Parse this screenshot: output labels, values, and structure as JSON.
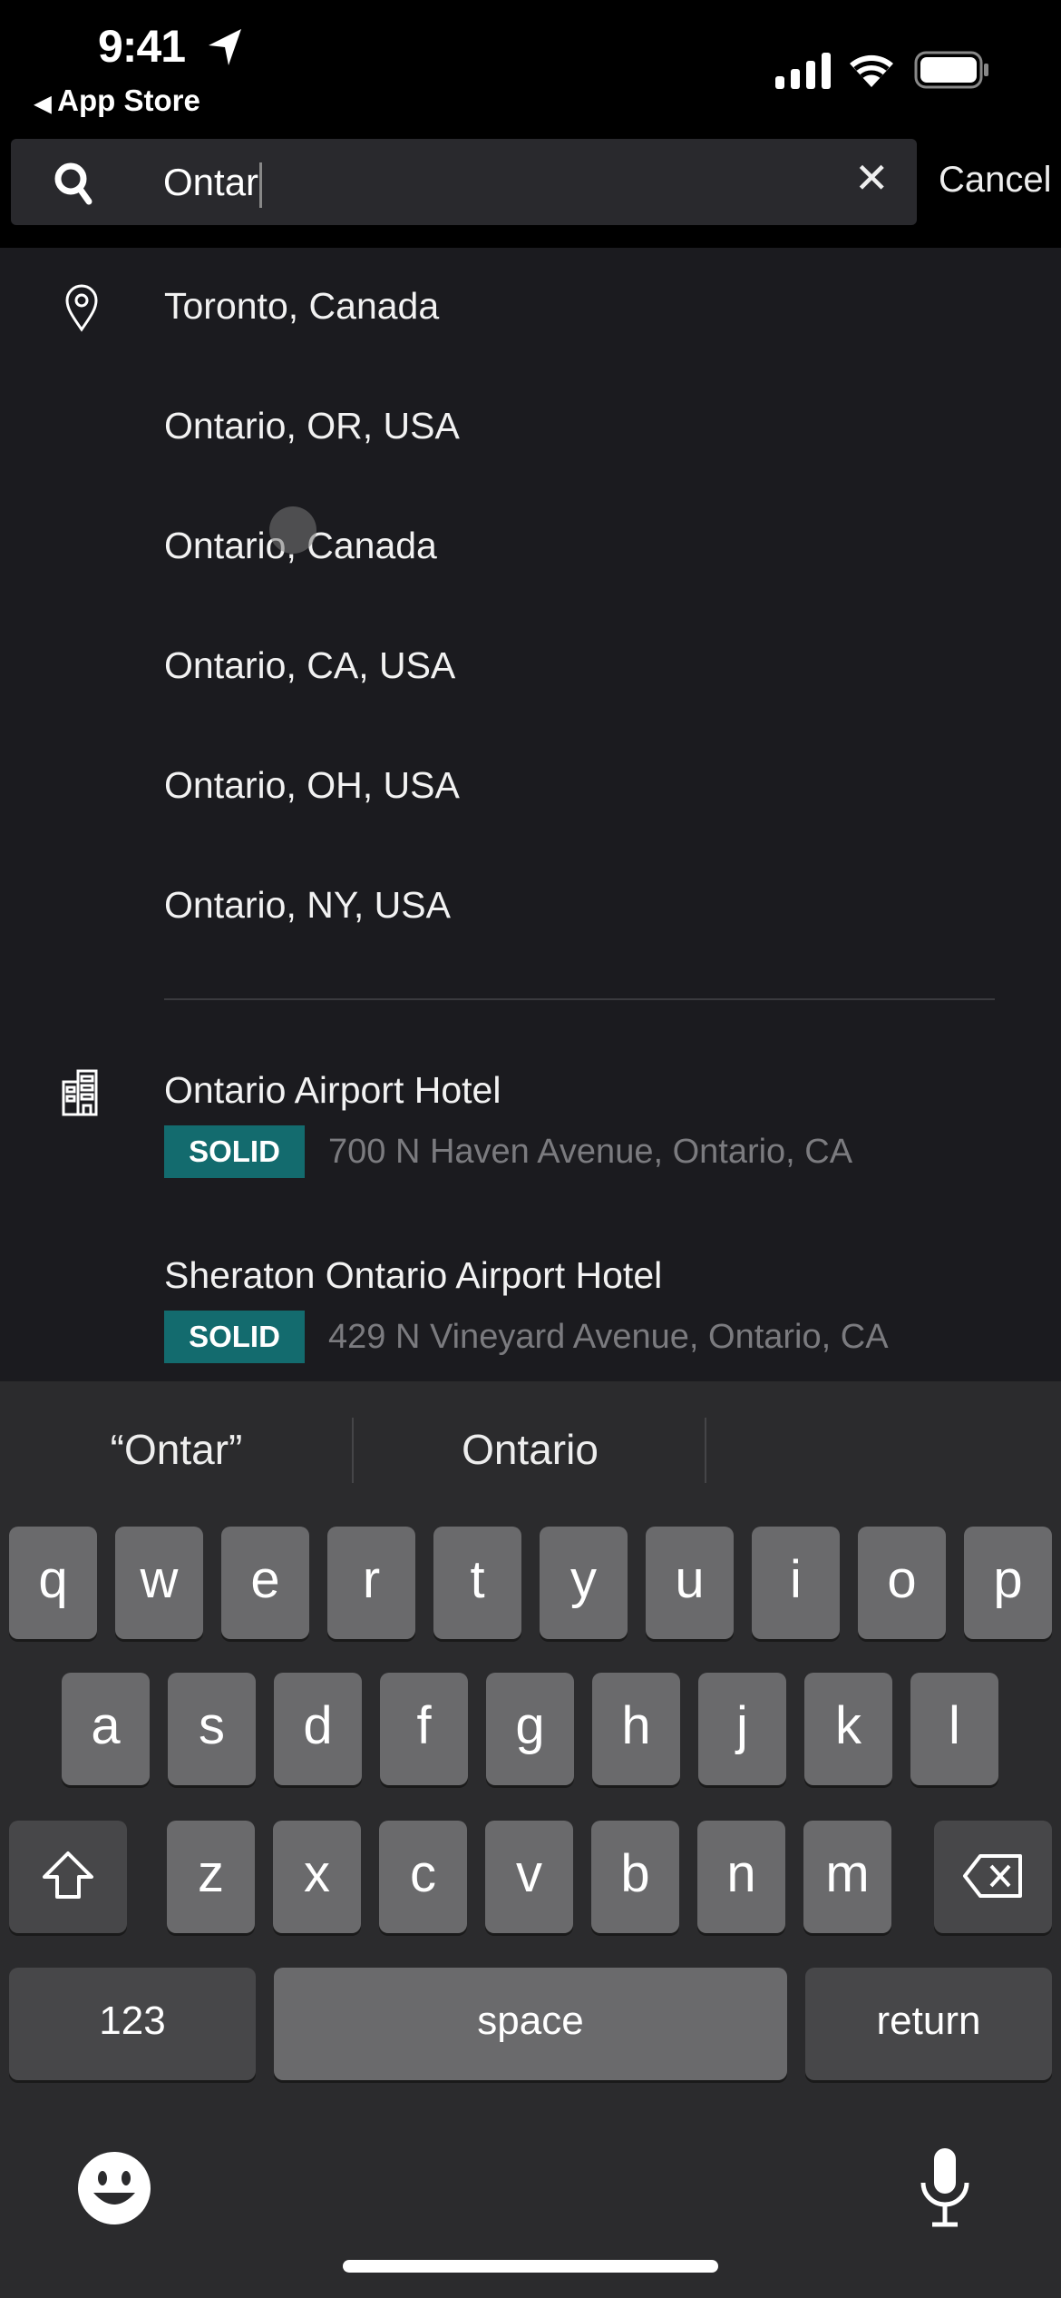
{
  "status_bar": {
    "time": "9:41",
    "back_label": "App Store",
    "icons": [
      "location-arrow-icon",
      "signal-icon",
      "wifi-icon",
      "battery-icon"
    ]
  },
  "search": {
    "value": "Ontar",
    "cancel_label": "Cancel"
  },
  "locations": [
    "Toronto, Canada",
    "Ontario, OR, USA",
    "Ontario, Canada",
    "Ontario, CA, USA",
    "Ontario, OH, USA",
    "Ontario, NY, USA"
  ],
  "hotels": [
    {
      "name": "Ontario Airport Hotel",
      "badge": "SOLID",
      "address": "700 N Haven Avenue, Ontario, CA"
    },
    {
      "name": "Sheraton Ontario Airport Hotel",
      "badge": "SOLID",
      "address": "429 N Vineyard Avenue, Ontario, CA"
    }
  ],
  "colors": {
    "badge": "#136b6e",
    "background": "#1b1b1f"
  },
  "keyboard": {
    "suggestions": [
      "“Ontar”",
      "Ontario"
    ],
    "rows": [
      [
        "q",
        "w",
        "e",
        "r",
        "t",
        "y",
        "u",
        "i",
        "o",
        "p"
      ],
      [
        "a",
        "s",
        "d",
        "f",
        "g",
        "h",
        "j",
        "k",
        "l"
      ],
      [
        "z",
        "x",
        "c",
        "v",
        "b",
        "n",
        "m"
      ]
    ],
    "numbers_label": "123",
    "space_label": "space",
    "return_label": "return"
  }
}
